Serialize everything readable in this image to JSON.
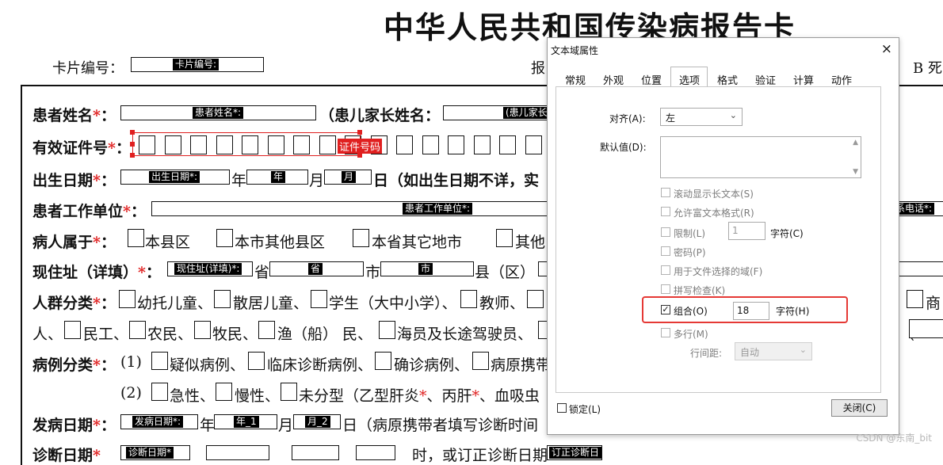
{
  "doc": {
    "title": "中华人民共和国传染病报告卡",
    "card_number_label": "卡片编号：",
    "card_number_field": "卡片编号:",
    "report_label": "报",
    "death_label": "B 死",
    "rows": {
      "name_label": "患者姓名",
      "name_field": "患者姓名*:",
      "parent_label": "（患儿家长姓名：",
      "parent_field": "(患儿家长",
      "id_label": "有效证件号",
      "id_field": "证件号码",
      "birth_label": "出生日期",
      "birth_field": "出生日期*:",
      "birth_year_unit": "年",
      "birth_year_field": "年",
      "birth_month_unit": "月",
      "birth_month_field": "月",
      "birth_day_unit": "日（如出生日期不详，实",
      "work_label": "患者工作单位",
      "work_field": "患者工作单位*:",
      "phone_field": "系电话*:",
      "belong_label": "病人属于",
      "belong_options": [
        "本县区",
        "本市其他县区",
        "本省其它地市",
        "其他"
      ],
      "address_label": "现住址（详填）",
      "address_field": "现住址(详填)*:",
      "province_unit": "省",
      "province_field": "省",
      "city_unit": "市",
      "city_field": "市",
      "county_unit": "县（区）",
      "crowd_label": "人群分类",
      "crowd_row1": [
        "幼托儿童、",
        "散居儿童、",
        "学生（大中小学）、",
        "教师、"
      ],
      "crowd_row1_tail": "商",
      "crowd_row2_head": "人、",
      "crowd_row2": [
        "民工、",
        "农民、",
        "牧民、",
        "渔（船） 民、",
        "海员及长途驾驶员、"
      ],
      "crowd_row2_tail": "（",
      "case_label": "病例分类",
      "case_row1_prefix": "(1)",
      "case_row1": [
        "疑似病例、",
        "临床诊断病例、",
        "确诊病例、",
        "病原携带"
      ],
      "case_row2_prefix": "(2)",
      "case_row2": [
        "急性、",
        "慢性、",
        "未分型（乙型肝炎",
        "、丙肝",
        "、血吸虫"
      ],
      "onset_label": "发病日期",
      "onset_field": "发病日期*:",
      "onset_year_unit": "年",
      "onset_year_field": "年_1",
      "onset_month_unit": "月",
      "onset_month_field": "月_2",
      "onset_day_unit": "日（病原携带者填写诊断时间",
      "diag_label": "诊断日期",
      "diag_field": "诊断日期*",
      "diag_tail": "时，或订正诊断日期",
      "diag_tail_field": "订正诊断日",
      "star": "*",
      "colon": "：",
      "colon_fw": "："
    }
  },
  "dialog": {
    "title": "文本域属性",
    "close_icon": "×",
    "tabs": [
      "常规",
      "外观",
      "位置",
      "选项",
      "格式",
      "验证",
      "计算",
      "动作"
    ],
    "active_tab": "选项",
    "align_label": "对齐(A):",
    "align_value": "左",
    "default_label": "默认值(D):",
    "options": [
      {
        "label": "滚动显示长文本(S)",
        "checked": false
      },
      {
        "label": "允许富文本格式(R)",
        "checked": false
      },
      {
        "label": "限制(L)",
        "checked": false
      },
      {
        "label": "密码(P)",
        "checked": false
      },
      {
        "label": "用于文件选择的域(F)",
        "checked": false
      },
      {
        "label": "拼写检查(K)",
        "checked": false
      },
      {
        "label": "组合(O)",
        "checked": true
      },
      {
        "label": "多行(M)",
        "checked": false
      }
    ],
    "limit_value": "1",
    "limit_unit": "字符(C)",
    "comb_value": "18",
    "comb_unit": "字符(H)",
    "line_spacing_label": "行间距:",
    "line_spacing_value": "自动",
    "lock_label": "锁定(L)",
    "close_button": "关闭(C)",
    "highlight_color": "#e53935"
  },
  "watermark": "CSDN @东南_bit"
}
